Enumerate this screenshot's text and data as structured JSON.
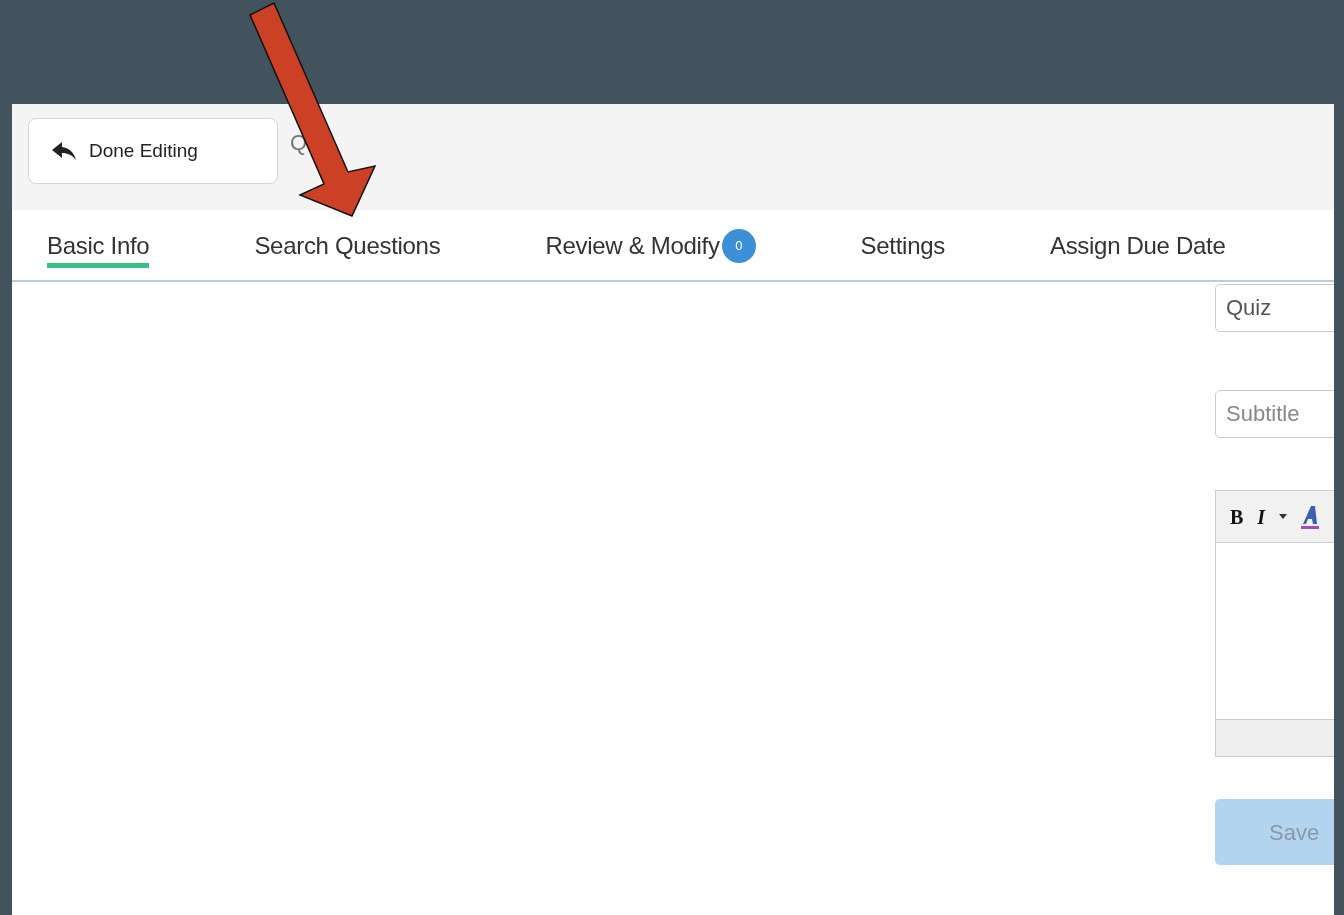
{
  "toolbar": {
    "done_button": "Done Editing",
    "title": "Q"
  },
  "tabs": [
    {
      "label": "Basic Info",
      "selected": true
    },
    {
      "label": "Search Questions",
      "selected": false
    },
    {
      "label": "Review & Modify",
      "selected": false,
      "badge": "0"
    },
    {
      "label": "Settings",
      "selected": false
    },
    {
      "label": "Assign Due Date",
      "selected": false
    }
  ],
  "form": {
    "title_value": "Quiz",
    "subtitle_placeholder": "Subtitle",
    "editor_buttons": [
      {
        "kind": "bold",
        "label": "B"
      },
      {
        "kind": "italic",
        "label": "I"
      },
      {
        "kind": "caret"
      },
      {
        "kind": "font-color"
      }
    ],
    "save_button": "Save"
  }
}
